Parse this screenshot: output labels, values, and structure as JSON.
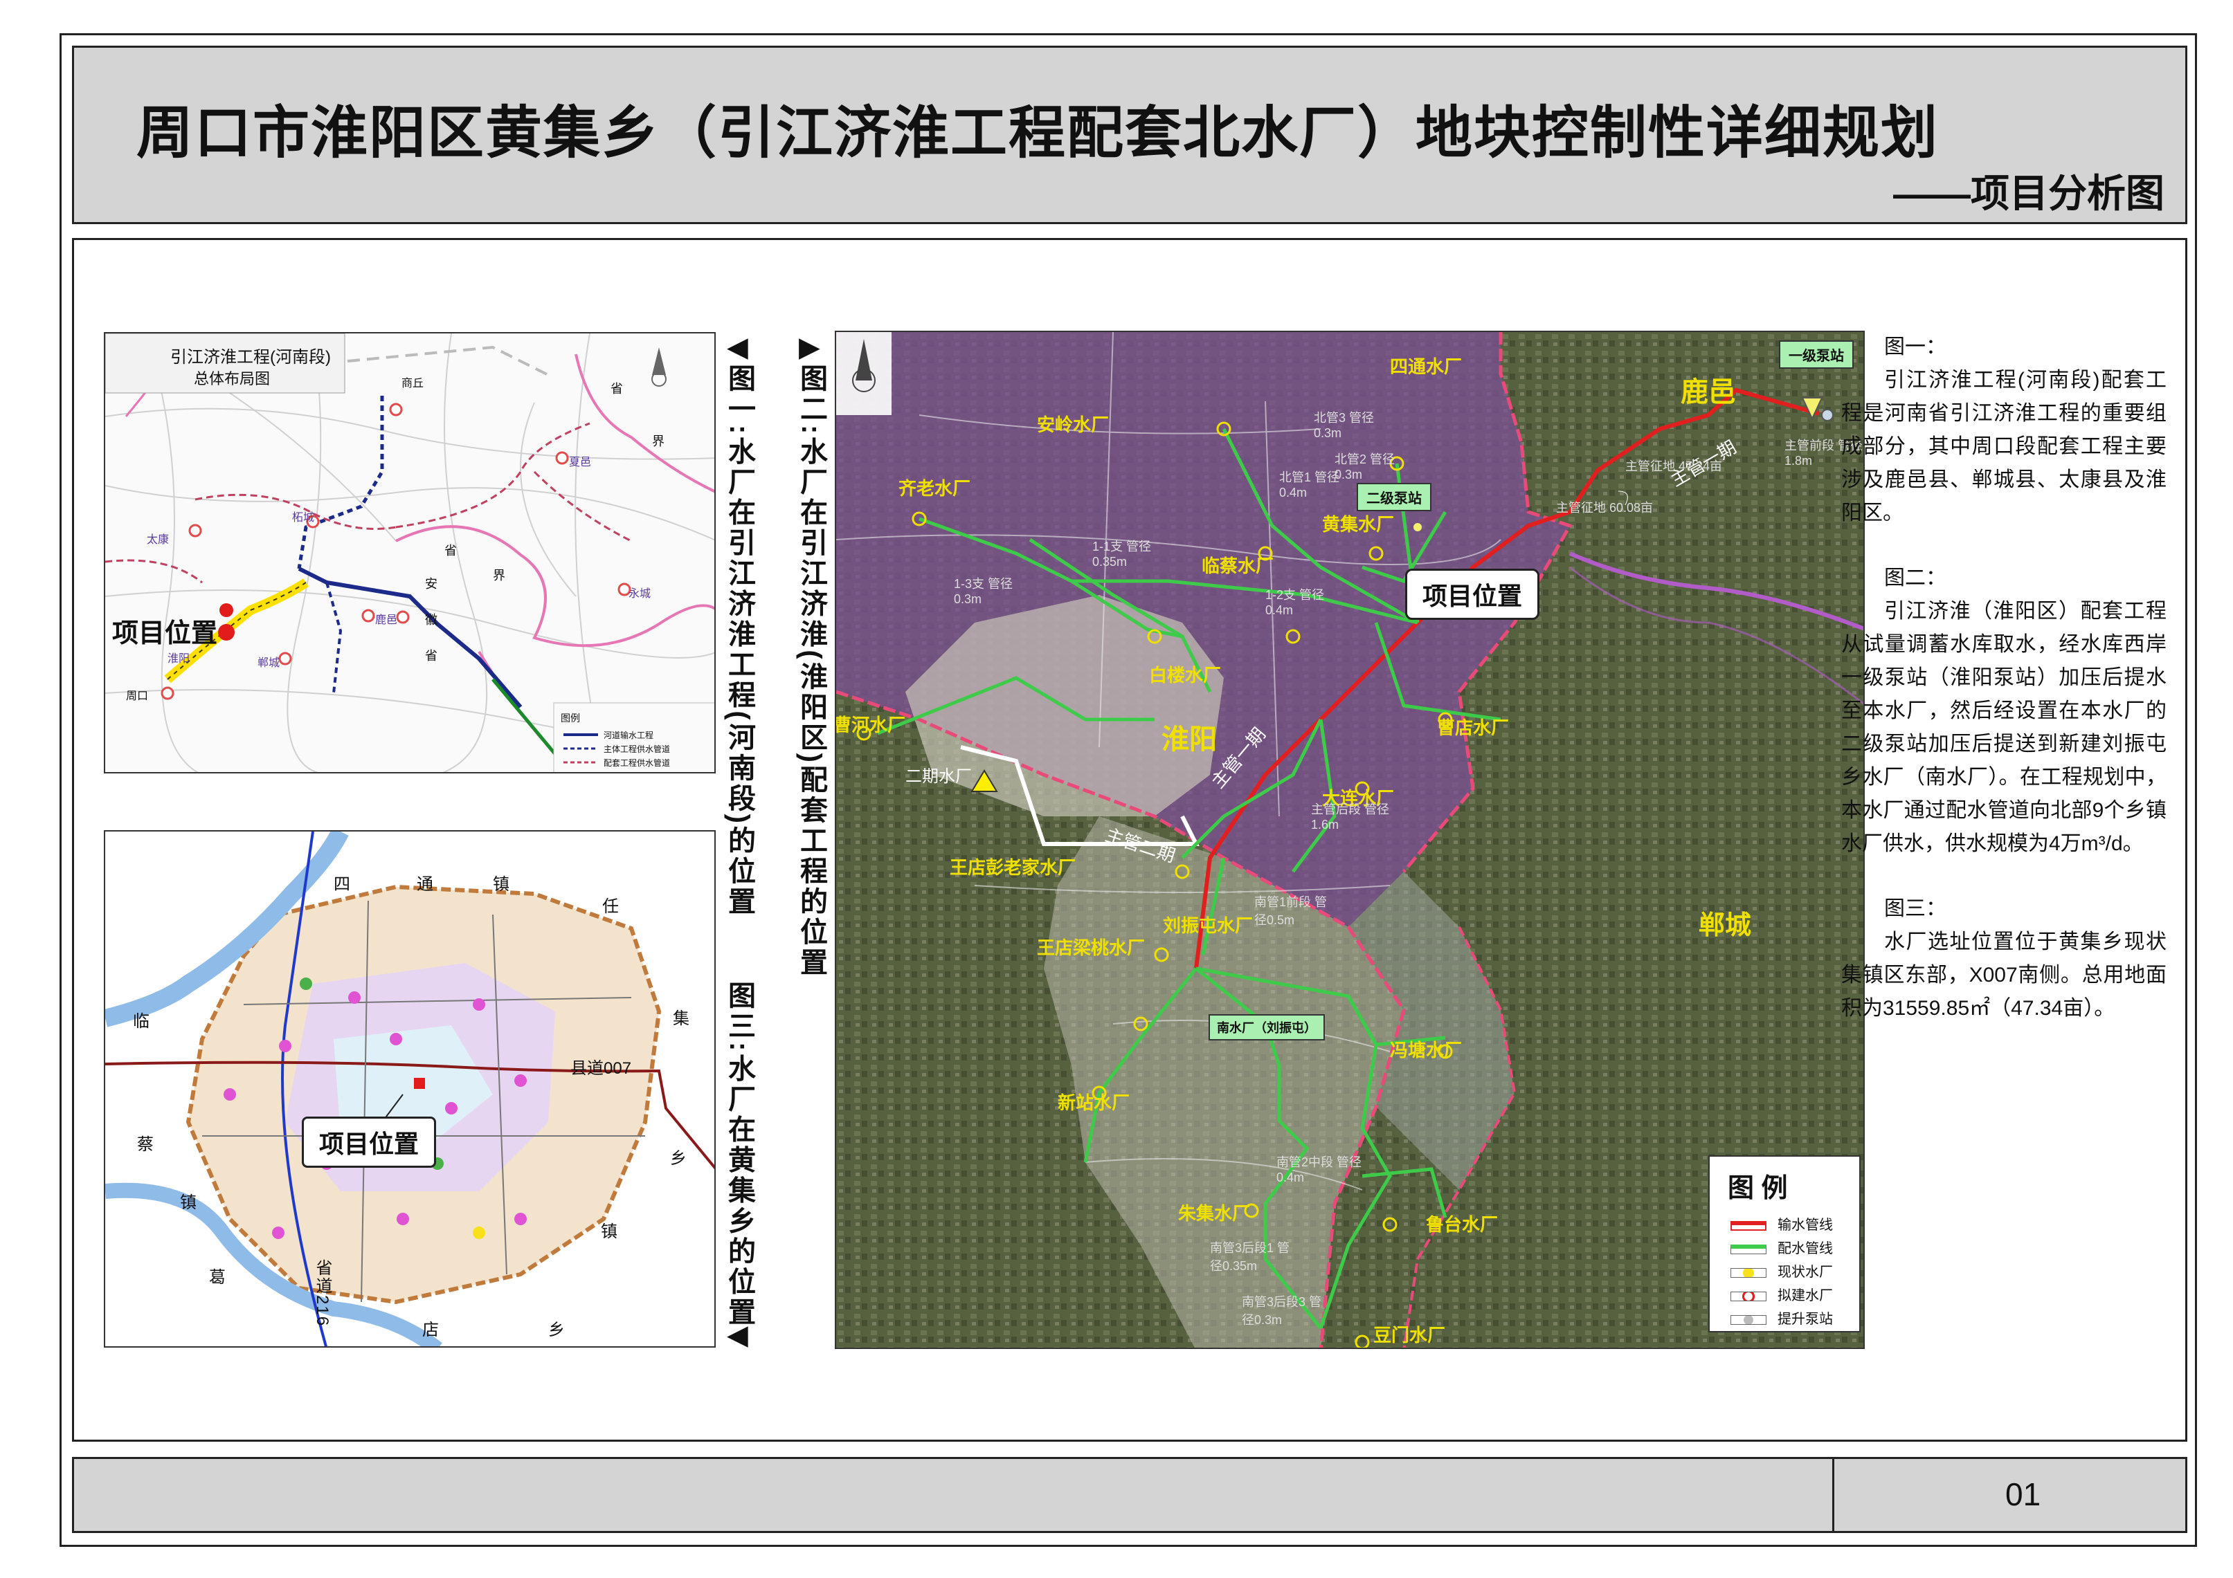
{
  "title": {
    "main": "周口市淮阳区黄集乡（引江济淮工程配套北水厂）地块控制性详细规划",
    "sub": "——项目分析图"
  },
  "page_number": "01",
  "figure1": {
    "map_title_line1": "引江济淮工程(河南段)",
    "map_title_line2": "总体布局图",
    "caption": "图一:水厂在引江济淮工程(河南段)的位置",
    "location_label": "项目位置",
    "cities": [
      "商丘",
      "夏邑",
      "柘城",
      "太康",
      "鹿邑",
      "郸城",
      "周口",
      "淮阳",
      "永城"
    ],
    "province_text": [
      "省",
      "界",
      "省",
      "安",
      "徽",
      "省",
      "界"
    ],
    "legend_title": "图例",
    "legend_items": [
      "河道输水工程",
      "主体工程供水管道",
      "配套工程供水管道"
    ]
  },
  "figure2": {
    "caption": "图二:水厂在引江济淮(淮阳区)配套工程的位置",
    "location_label": "项目位置",
    "pump_station_1": "一级泵站",
    "pump_station_2": "二级泵站",
    "county_labels": [
      "鹿邑",
      "郸城",
      "淮阳"
    ],
    "south_plant": "南水厂（刘振屯）",
    "trunk_labels": [
      "主管一期",
      "主管一期",
      "主管二期"
    ],
    "plant_labels": [
      "四通水厂",
      "安岭水厂",
      "齐老水厂",
      "黄集水厂",
      "临蔡水厂",
      "白楼水厂",
      "曹河水厂",
      "曹店水厂",
      "大连水厂",
      "二期水厂",
      "王店彭老家水厂",
      "刘振屯水厂",
      "王店梁桃水厂",
      "冯塘水厂",
      "新站水厂",
      "朱集水厂",
      "鲁台水厂",
      "豆门水厂"
    ],
    "pipe_labels": [
      "北管3 管径0.3m",
      "北管2 管径0.3m",
      "北管1 管径0.4m",
      "1-1支 管径0.35m",
      "1-2支 管径0.4m",
      "1-3支 管径0.3m",
      "主管前段 管径1.8m",
      "主管征地 47.34亩",
      "主管征地 60.08亩",
      "主管后段 管径1.6m",
      "南管1前段 管径0.5m",
      "南管2中段 管径0.4m",
      "南管3后段1 管径0.35m",
      "南管3后段3 管径0.3m"
    ],
    "legend_title": "图 例",
    "legend_items": [
      "输水管线",
      "配水管线",
      "现状水厂",
      "拟建水厂",
      "提升泵站"
    ]
  },
  "figure3": {
    "caption": "图三:水厂在黄集乡的位置",
    "location_label": "项目位置",
    "road_label": "县道007",
    "road_label2": "省道216",
    "chars": [
      "四",
      "通",
      "镇",
      "任",
      "集",
      "乡",
      "店",
      "乡",
      "镇",
      "葛",
      "镇",
      "蔡",
      "临"
    ]
  },
  "description": {
    "fig1_heading": "图一：",
    "fig1_text": "引江济淮工程(河南段)配套工程是河南省引江济淮工程的重要组成部分，其中周口段配套工程主要涉及鹿邑县、郸城县、太康县及淮阳区。",
    "fig2_heading": "图二：",
    "fig2_text": "引江济淮（淮阳区）配套工程从试量调蓄水库取水，经水库西岸一级泵站（淮阳泵站）加压后提水至本水厂，然后经设置在本水厂的二级泵站加压后提送到新建刘振屯乡水厂（南水厂）。在工程规划中，本水厂通过配水管道向北部9个乡镇水厂供水，供水规模为4万m³/d。",
    "fig3_heading": "图三：",
    "fig3_text": "水厂选址位置位于黄集乡现状集镇区东部，X007南侧。总用地面积为31559.85㎡（47.34亩）。"
  },
  "colors": {
    "title_bg": "#d4d4d4",
    "transmission_pipe": "#e0221f",
    "distribution_pipe": "#3fcb4a",
    "plant_label": "#f0e000",
    "boundary": "#e0407a"
  }
}
